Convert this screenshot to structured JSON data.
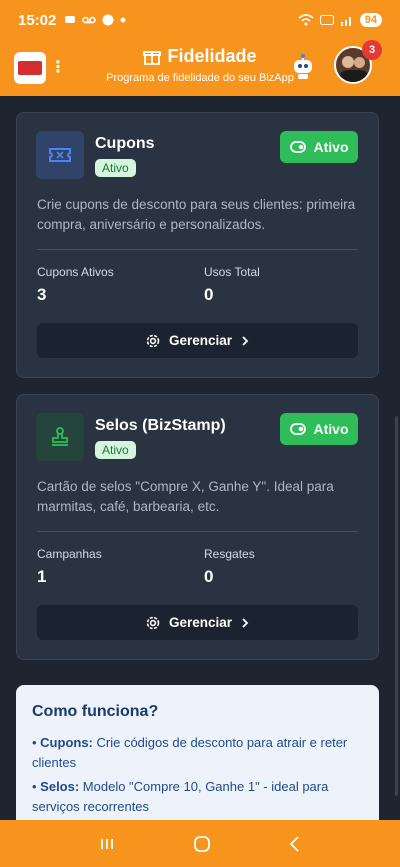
{
  "status": {
    "time": "15:02",
    "icons": [
      "msg-icon",
      "voicemail-icon",
      "messenger-icon",
      "dot-icon"
    ],
    "battery": "94"
  },
  "header": {
    "title": "Fidelidade",
    "subtitle": "Programa de fidelidade do seu BizApp",
    "notification_count": "3"
  },
  "cards": [
    {
      "name": "Cupons",
      "status_pill": "Ativo",
      "toggle_label": "Ativo",
      "description": "Crie cupons de desconto para seus clientes: primeira compra, aniversário e personalizados.",
      "stat1_label": "Cupons Ativos",
      "stat1_value": "3",
      "stat2_label": "Usos Total",
      "stat2_value": "0",
      "manage_label": "Gerenciar",
      "icon": "ticket-icon",
      "icon_color": "#3b6cd6"
    },
    {
      "name": "Selos (BizStamp)",
      "status_pill": "Ativo",
      "toggle_label": "Ativo",
      "description": "Cartão de selos \"Compre X, Ganhe Y\". Ideal para marmitas, café, barbearia, etc.",
      "stat1_label": "Campanhas",
      "stat1_value": "1",
      "stat2_label": "Resgates",
      "stat2_value": "0",
      "manage_label": "Gerenciar",
      "icon": "stamp-icon",
      "icon_color": "#2ebd59"
    }
  ],
  "how": {
    "title": "Como funciona?",
    "items": [
      {
        "term": "Cupons:",
        "text": " Crie códigos de desconto para atrair e reter clientes"
      },
      {
        "term": "Selos:",
        "text": " Modelo \"Compre 10, Ganhe 1\" - ideal para serviços recorrentes"
      }
    ]
  },
  "colors": {
    "brand": "#f7941d",
    "active_green": "#2ebd59",
    "card_bg": "#2a3342",
    "page_bg": "#1e2430"
  }
}
